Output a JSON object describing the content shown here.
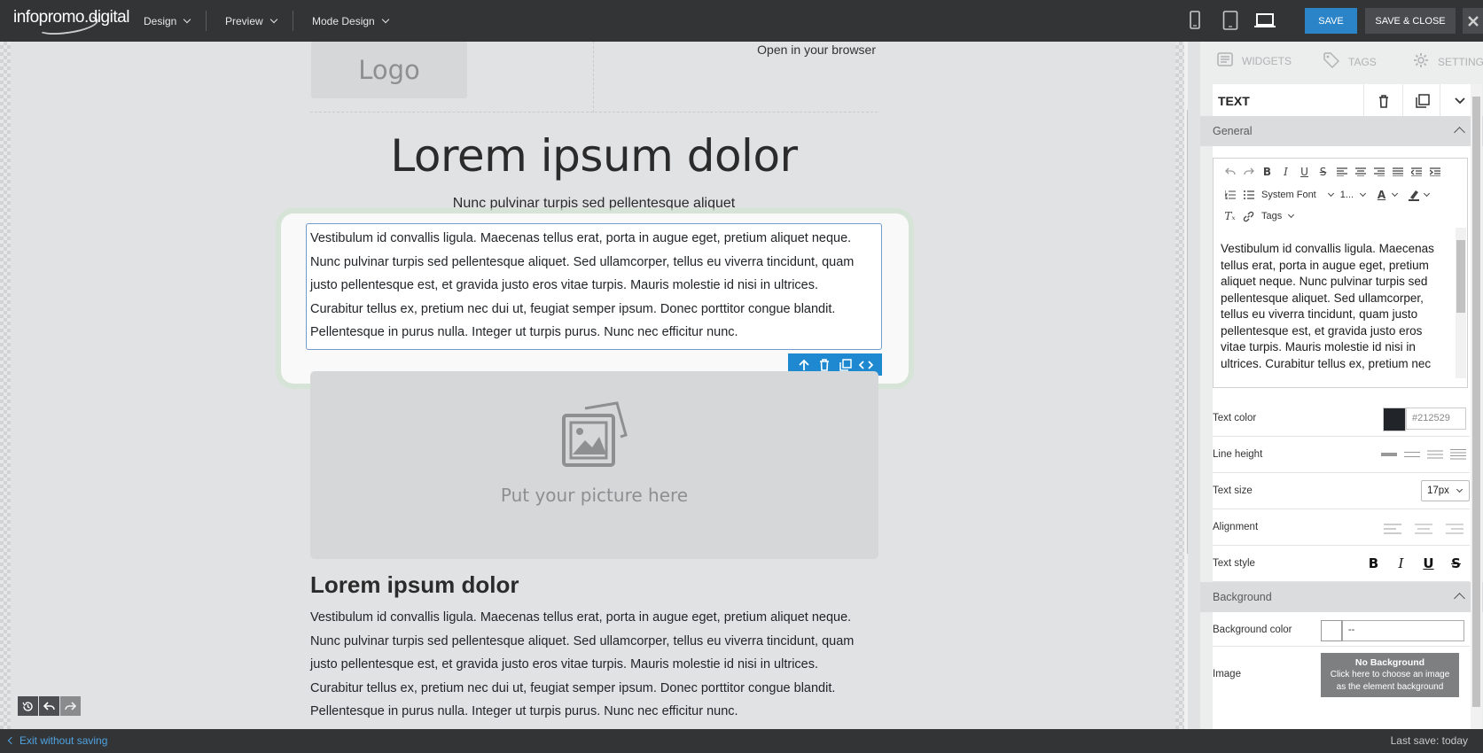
{
  "app": {
    "brand": "infopromo.digital",
    "menu": [
      {
        "label": "Design"
      },
      {
        "label": "Preview"
      },
      {
        "label": "Mode Design"
      }
    ],
    "devices": [
      "mobile-icon",
      "tablet-icon",
      "desktop-icon"
    ],
    "save_label": "SAVE",
    "save_close_label": "SAVE & CLOSE",
    "accent_color": "#2a84c7"
  },
  "canvas": {
    "logo_text": "Logo",
    "open_browser": "Open in your browser",
    "hero_title": "Lorem ipsum dolor",
    "hero_subtitle": "Nunc pulvinar turpis sed pellentesque aliquet",
    "selected_text_lines": [
      "Vestibulum id convallis ligula. Maecenas tellus erat, porta in augue eget, pretium aliquet neque.",
      "Nunc pulvinar turpis sed pellentesque aliquet. Sed ullamcorper, tellus eu viverra tincidunt, quam",
      "justo pellentesque est, et gravida justo eros vitae turpis. Mauris molestie id nisi in ultrices.",
      "Curabitur tellus ex, pretium nec dui ut, feugiat semper ipsum. Donec porttitor congue blandit.",
      "Pellentesque in purus nulla. Integer ut turpis purus. Nunc nec efficitur nunc."
    ],
    "picture_label": "Put your picture here",
    "section_title": "Lorem ipsum dolor",
    "section_body_lines": [
      "Vestibulum id convallis ligula. Maecenas tellus erat, porta in augue eget, pretium aliquet neque.",
      "Nunc pulvinar turpis sed pellentesque aliquet. Sed ullamcorper, tellus eu viverra tincidunt, quam",
      "justo pellentesque est, et gravida justo eros vitae turpis. Mauris molestie id nisi in ultrices.",
      "Curabitur tellus ex, pretium nec dui ut, feugiat semper ipsum. Donec porttitor congue blandit.",
      "Pellentesque in purus nulla. Integer ut turpis purus. Nunc nec efficitur nunc."
    ]
  },
  "bottom": {
    "exit_label": "Exit without saving",
    "last_save": "Last save: today"
  },
  "panel": {
    "tabs": [
      {
        "label": "WIDGETS",
        "icon": "widgets-icon"
      },
      {
        "label": "TAGS",
        "icon": "tag-icon"
      },
      {
        "label": "SETTING",
        "icon": "gear-icon"
      }
    ],
    "element_title": "TEXT",
    "general_label": "General",
    "editor": {
      "font_select": "System Font",
      "size_select": "1...",
      "tags_select": "Tags",
      "content_lines": [
        "Vestibulum id convallis ligula. Maecenas",
        "tellus erat, porta in augue eget, pretium",
        "aliquet neque. Nunc pulvinar turpis sed",
        "pellentesque aliquet. Sed ullamcorper,",
        "tellus eu viverra tincidunt, quam justo",
        "pellentesque est, et gravida justo eros",
        "vitae turpis. Mauris molestie id nisi in",
        "ultrices. Curabitur tellus ex, pretium nec"
      ]
    },
    "text_color_label": "Text color",
    "text_color_value": "#212529",
    "line_height_label": "Line height",
    "text_size_label": "Text size",
    "text_size_value": "17px",
    "alignment_label": "Alignment",
    "text_style_label": "Text style",
    "text_style_buttons": [
      "B",
      "I",
      "U",
      "S"
    ],
    "background_label": "Background",
    "background_color_label": "Background color",
    "background_color_value": "--",
    "image_label": "Image",
    "no_background_title": "No Background",
    "no_background_hint_1": "Click here to choose an image",
    "no_background_hint_2": "as the element background"
  }
}
